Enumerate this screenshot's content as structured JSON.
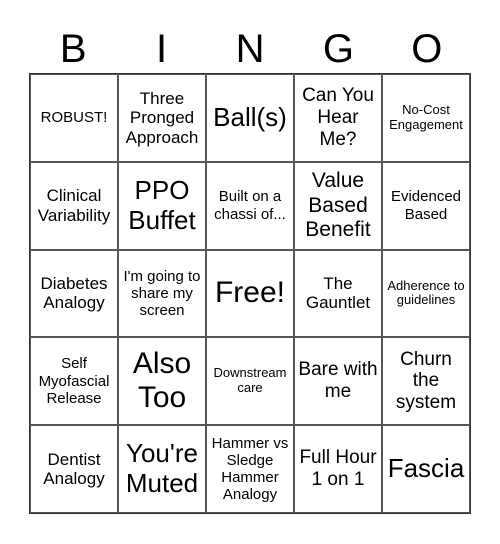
{
  "header": [
    "B",
    "I",
    "N",
    "G",
    "O"
  ],
  "cells": [
    {
      "text": "ROBUST!",
      "size": "s15"
    },
    {
      "text": "Three Pronged Approach",
      "size": "s17"
    },
    {
      "text": "Ball(s)",
      "size": "s26"
    },
    {
      "text": "Can You Hear Me?",
      "size": "s19"
    },
    {
      "text": "No-Cost Engagement",
      "size": "s13"
    },
    {
      "text": "Clinical Variability",
      "size": "s17"
    },
    {
      "text": "PPO Buffet",
      "size": "s26"
    },
    {
      "text": "Built on a chassi of...",
      "size": "s15"
    },
    {
      "text": "Value Based Benefit",
      "size": "s21"
    },
    {
      "text": "Evidenced Based",
      "size": "s15"
    },
    {
      "text": "Diabetes Analogy",
      "size": "s17"
    },
    {
      "text": "I'm going to share my screen",
      "size": "s15"
    },
    {
      "text": "Free!",
      "size": "s30"
    },
    {
      "text": "The Gauntlet",
      "size": "s17"
    },
    {
      "text": "Adherence to guidelines",
      "size": "s13"
    },
    {
      "text": "Self Myofascial Release",
      "size": "s15"
    },
    {
      "text": "Also Too",
      "size": "s30"
    },
    {
      "text": "Downstream care",
      "size": "s13"
    },
    {
      "text": "Bare with me",
      "size": "s19"
    },
    {
      "text": "Churn the system",
      "size": "s19"
    },
    {
      "text": "Dentist Analogy",
      "size": "s17"
    },
    {
      "text": "You're Muted",
      "size": "s26"
    },
    {
      "text": "Hammer vs Sledge Hammer Analogy",
      "size": "s15"
    },
    {
      "text": "Full Hour 1 on 1",
      "size": "s19"
    },
    {
      "text": "Fascia",
      "size": "s26"
    }
  ]
}
